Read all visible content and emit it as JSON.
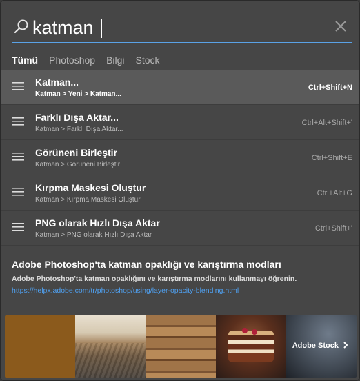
{
  "search": {
    "value": "katman",
    "placeholder": ""
  },
  "tabs": [
    {
      "label": "Tümü",
      "active": true
    },
    {
      "label": "Photoshop",
      "active": false
    },
    {
      "label": "Bilgi",
      "active": false
    },
    {
      "label": "Stock",
      "active": false
    }
  ],
  "results": [
    {
      "title": "Katman...",
      "path": "Katman > Yeni > Katman...",
      "shortcut": "Ctrl+Shift+N",
      "selected": true
    },
    {
      "title": "Farklı Dışa Aktar...",
      "path": "Katman > Farklı Dışa Aktar...",
      "shortcut": "Ctrl+Alt+Shift+'",
      "selected": false
    },
    {
      "title": "Görüneni Birleştir",
      "path": "Katman > Görüneni Birleştir",
      "shortcut": "Ctrl+Shift+E",
      "selected": false
    },
    {
      "title": "Kırpma Maskesi Oluştur",
      "path": "Katman > Kırpma Maskesi Oluştur",
      "shortcut": "Ctrl+Alt+G",
      "selected": false
    },
    {
      "title": "PNG olarak Hızlı Dışa Aktar",
      "path": "Katman > PNG olarak Hızlı Dışa Aktar",
      "shortcut": "Ctrl+Shift+'",
      "selected": false
    }
  ],
  "learn": {
    "title": "Adobe Photoshop'ta katman opaklığı ve karıştırma modları",
    "description": "Adobe Photoshop'ta katman opaklığını ve karıştırma modlarını kullanmayı öğrenin.",
    "link": "https://helpx.adobe.com/tr/photoshop/using/layer-opacity-blending.html"
  },
  "stock": {
    "label": "Adobe Stock",
    "label_icon": "chevron-right-icon"
  },
  "colors": {
    "panel_bg": "#464646",
    "selected_row": "#5a5a5a",
    "accent_underline": "#5aa2e6",
    "link": "#4fa0f0"
  }
}
